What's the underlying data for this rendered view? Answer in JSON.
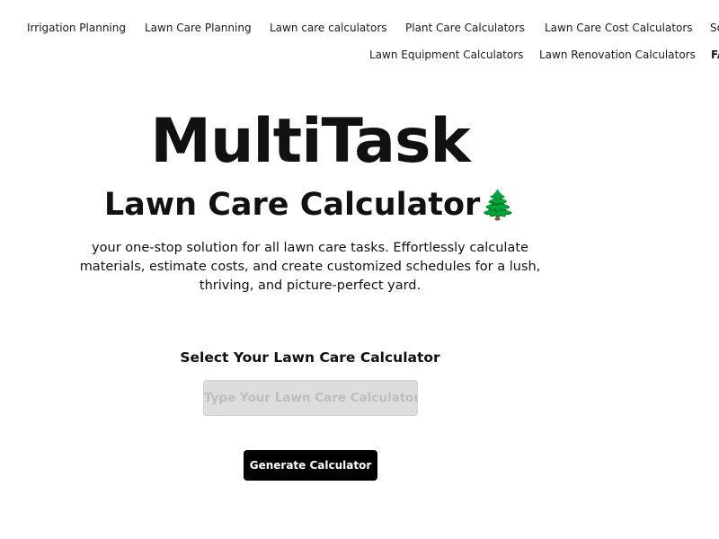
{
  "nav": {
    "row1": [
      "Irrigation Planning",
      "Lawn Care Planning",
      "Lawn care calculators",
      "Plant Care Calculators",
      "Lawn Care Cost Calculators",
      "So"
    ],
    "row2": [
      "Lawn Equipment Calculators",
      "Lawn Renovation Calculators",
      "FA"
    ]
  },
  "hero": {
    "title": "MultiTask",
    "subtitle": "Lawn Care Calculator",
    "subtitle_emoji": "🌲",
    "description": "your one-stop solution for all lawn care tasks. Effortlessly calculate materials, estimate costs, and create customized schedules for a lush, thriving, and picture-perfect yard."
  },
  "form": {
    "label": "Select Your Lawn Care Calculator",
    "input_placeholder": "Type Your Lawn Care Calculator",
    "input_value": "",
    "button_label": "Generate Calculator"
  }
}
